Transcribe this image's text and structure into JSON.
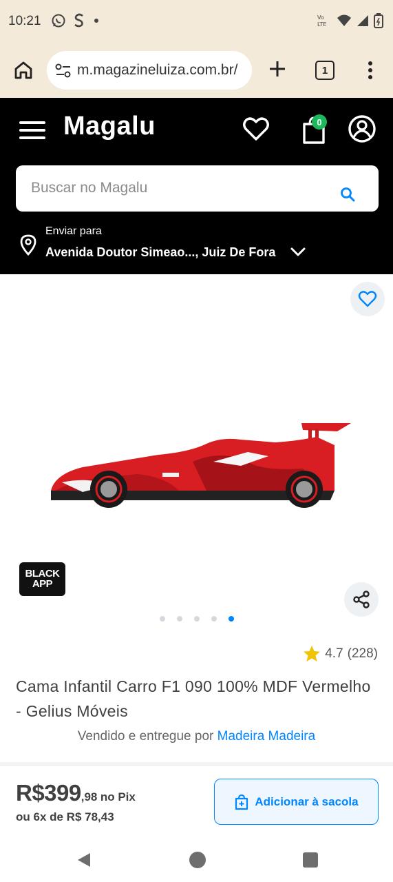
{
  "status_bar": {
    "time": "10:21",
    "left_icons": [
      "whatsapp-icon",
      "skype-icon",
      "dot-icon"
    ],
    "right_icons": [
      "volte-icon",
      "wifi-icon",
      "signal-icon",
      "battery-icon"
    ],
    "volte_text": "Vo LTE"
  },
  "browser": {
    "url": "m.magazineluiza.com.br/",
    "tab_count": "1"
  },
  "header": {
    "logo": "Magalu",
    "cart_count": "0",
    "search_placeholder": "Buscar no Magalu",
    "ship_label": "Enviar para",
    "ship_address": "Avenida Doutor Simeao..., Juiz De Fora"
  },
  "product": {
    "badge_line1": "BLACK",
    "badge_line2": "APP",
    "image_count": 5,
    "active_image": 5,
    "rating": "4.7",
    "reviews": "(228)",
    "title": "Cama Infantil Carro F1 090 100% MDF Vermelho - Gelius Móveis",
    "sold_by_prefix": "Vendido e entregue por",
    "seller": "Madeira Madeira"
  },
  "price": {
    "integer": "R$399",
    "cents": ",98",
    "pix": "no Pix",
    "installments": "ou 6x de R$ 78,43",
    "add_to_bag": "Adicionar à sacola"
  },
  "colors": {
    "accent": "#0086ff",
    "header_bg": "#000000",
    "status_bg": "#f3ead9",
    "badge_green": "#1bb95c",
    "star": "#f0c400"
  }
}
